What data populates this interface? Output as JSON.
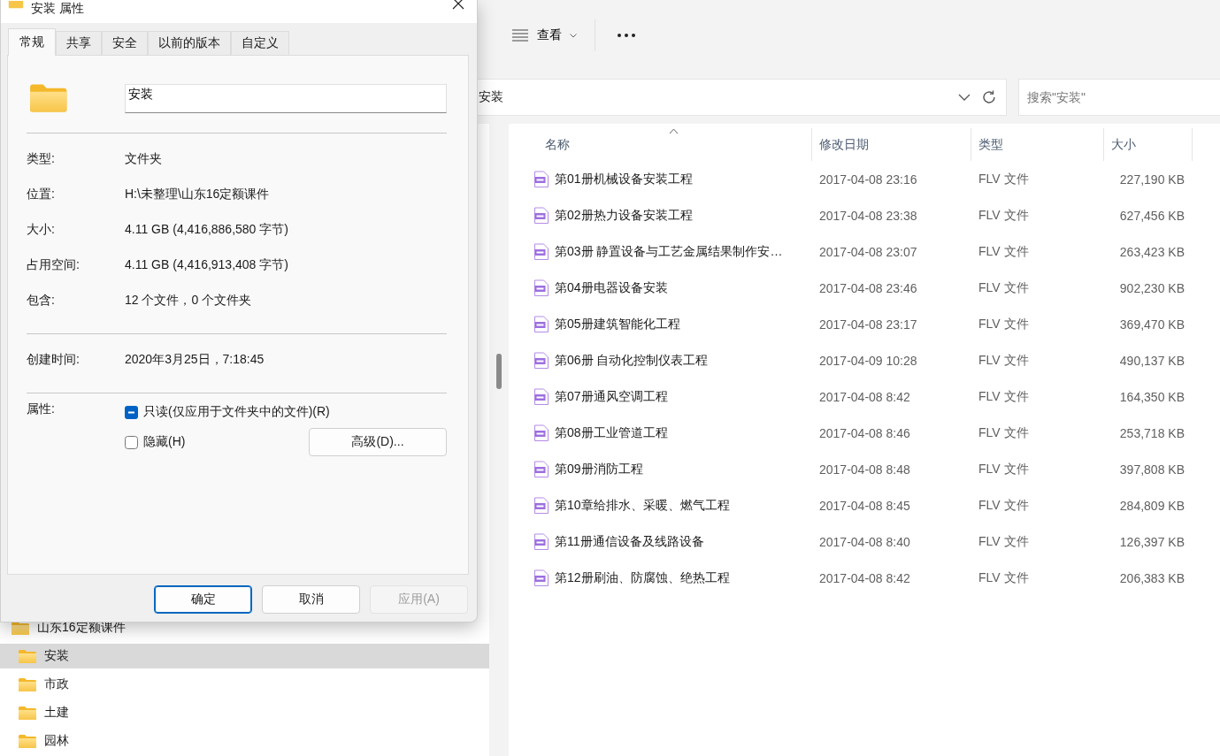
{
  "explorer": {
    "toolbar": {
      "view_button": "查看"
    },
    "address_bar": {
      "path": "安装"
    },
    "search": {
      "placeholder": "搜索\"安装\""
    },
    "nav_tree": [
      {
        "label": "山东16定额课件",
        "selected": false,
        "children": [
          {
            "label": "安装",
            "selected": true
          },
          {
            "label": "市政",
            "selected": false
          },
          {
            "label": "土建",
            "selected": false
          },
          {
            "label": "园林",
            "selected": false
          }
        ]
      }
    ],
    "file_list": {
      "columns": [
        {
          "label": "名称",
          "sorted": true
        },
        {
          "label": "修改日期",
          "sorted": false
        },
        {
          "label": "类型",
          "sorted": false
        },
        {
          "label": "大小",
          "sorted": false
        }
      ],
      "rows": [
        {
          "name": "第01册机械设备安装工程",
          "modified": "2017-04-08 23:16",
          "type": "FLV 文件",
          "size": "227,190 KB"
        },
        {
          "name": "第02册热力设备安装工程",
          "modified": "2017-04-08 23:38",
          "type": "FLV 文件",
          "size": "627,456 KB"
        },
        {
          "name": "第03册 静置设备与工艺金属结果制作安…",
          "modified": "2017-04-08 23:07",
          "type": "FLV 文件",
          "size": "263,423 KB"
        },
        {
          "name": "第04册电器设备安装",
          "modified": "2017-04-08 23:46",
          "type": "FLV 文件",
          "size": "902,230 KB"
        },
        {
          "name": "第05册建筑智能化工程",
          "modified": "2017-04-08 23:17",
          "type": "FLV 文件",
          "size": "369,470 KB"
        },
        {
          "name": "第06册 自动化控制仪表工程",
          "modified": "2017-04-09 10:28",
          "type": "FLV 文件",
          "size": "490,137 KB"
        },
        {
          "name": "第07册通风空调工程",
          "modified": "2017-04-08 8:42",
          "type": "FLV 文件",
          "size": "164,350 KB"
        },
        {
          "name": "第08册工业管道工程",
          "modified": "2017-04-08 8:46",
          "type": "FLV 文件",
          "size": "253,718 KB"
        },
        {
          "name": "第09册消防工程",
          "modified": "2017-04-08 8:48",
          "type": "FLV 文件",
          "size": "397,808 KB"
        },
        {
          "name": "第10章给排水、采暖、燃气工程",
          "modified": "2017-04-08 8:45",
          "type": "FLV 文件",
          "size": "284,809 KB"
        },
        {
          "name": "第11册通信设备及线路设备",
          "modified": "2017-04-08 8:40",
          "type": "FLV 文件",
          "size": "126,397 KB"
        },
        {
          "name": "第12册刷油、防腐蚀、绝热工程",
          "modified": "2017-04-08 8:42",
          "type": "FLV 文件",
          "size": "206,383 KB"
        }
      ]
    }
  },
  "dialog": {
    "title": "安装 属性",
    "tabs": [
      {
        "label": "常规",
        "selected": true
      },
      {
        "label": "共享",
        "selected": false
      },
      {
        "label": "安全",
        "selected": false
      },
      {
        "label": "以前的版本",
        "selected": false
      },
      {
        "label": "自定义",
        "selected": false
      }
    ],
    "name_field": {
      "value": "安装"
    },
    "info_groups": [
      [
        {
          "label": "类型:",
          "value": "文件夹"
        },
        {
          "label": "位置:",
          "value": "H:\\未整理\\山东16定额课件"
        },
        {
          "label": "大小:",
          "value": "4.11 GB (4,416,886,580 字节)"
        },
        {
          "label": "占用空间:",
          "value": "4.11 GB (4,416,913,408 字节)"
        },
        {
          "label": "包含:",
          "value": "12 个文件，0 个文件夹"
        }
      ],
      [
        {
          "label": "创建时间:",
          "value": "2020年3月25日，7:18:45"
        }
      ]
    ],
    "attributes": {
      "label": "属性:",
      "items": [
        {
          "label": "只读(仅应用于文件夹中的文件)(R)",
          "checked": false,
          "mixed": true
        },
        {
          "label": "隐藏(H)",
          "checked": false,
          "mixed": false
        }
      ],
      "advanced_button": "高级(D)..."
    },
    "buttons": [
      {
        "label": "确定",
        "default": true,
        "disabled": false
      },
      {
        "label": "取消",
        "default": false,
        "disabled": false
      },
      {
        "label": "应用(A)",
        "default": false,
        "disabled": true
      }
    ]
  }
}
